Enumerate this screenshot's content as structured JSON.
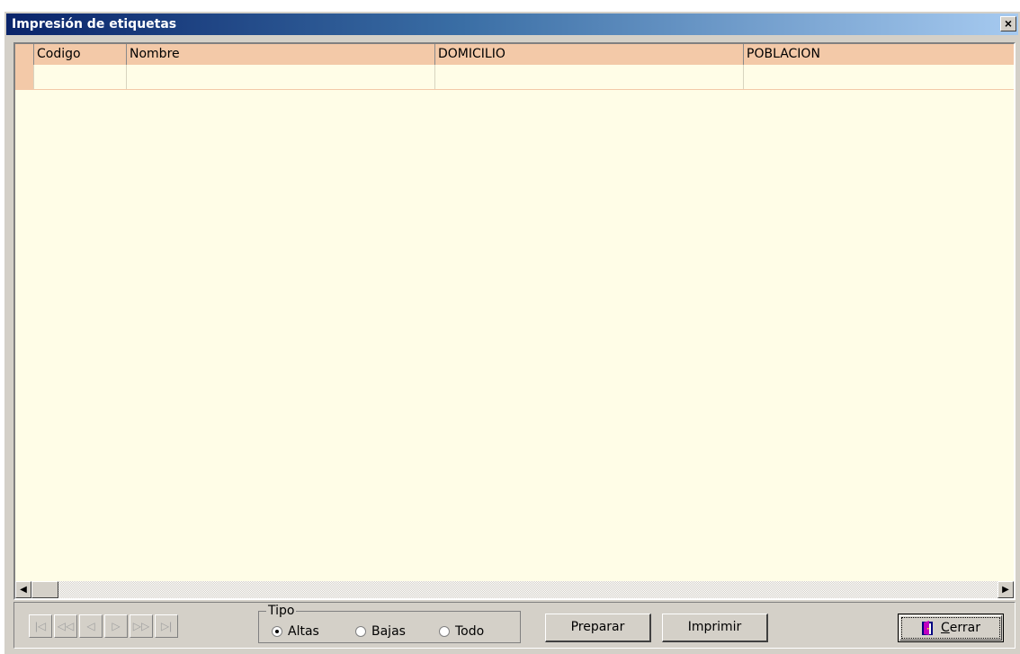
{
  "window": {
    "title": "Impresión de etiquetas",
    "close_glyph": "×"
  },
  "grid": {
    "columns": [
      "Codigo",
      "Nombre",
      "DOMICILIO",
      "POBLACION"
    ],
    "rows": [
      [
        "",
        "",
        "",
        ""
      ]
    ],
    "header_color": "#f3c9a8",
    "background_color": "#fffde7"
  },
  "scrollbar": {
    "left_glyph": "◀",
    "right_glyph": "▶"
  },
  "navigator": {
    "buttons": [
      {
        "name": "first",
        "glyph": "|◁"
      },
      {
        "name": "prior-page",
        "glyph": "◁◁"
      },
      {
        "name": "prior",
        "glyph": "◁"
      },
      {
        "name": "next",
        "glyph": "▷"
      },
      {
        "name": "next-page",
        "glyph": "▷▷"
      },
      {
        "name": "last",
        "glyph": "▷|"
      }
    ]
  },
  "tipo": {
    "legend": "Tipo",
    "options": [
      {
        "label": "Altas",
        "checked": true
      },
      {
        "label": "Bajas",
        "checked": false
      },
      {
        "label": "Todo",
        "checked": false
      }
    ]
  },
  "buttons": {
    "preparar": "Preparar",
    "imprimir": "Imprimir",
    "cerrar_hotkey": "C",
    "cerrar_rest": "errar"
  },
  "icons": {
    "close": "close-icon",
    "door": "door-exit-icon"
  }
}
